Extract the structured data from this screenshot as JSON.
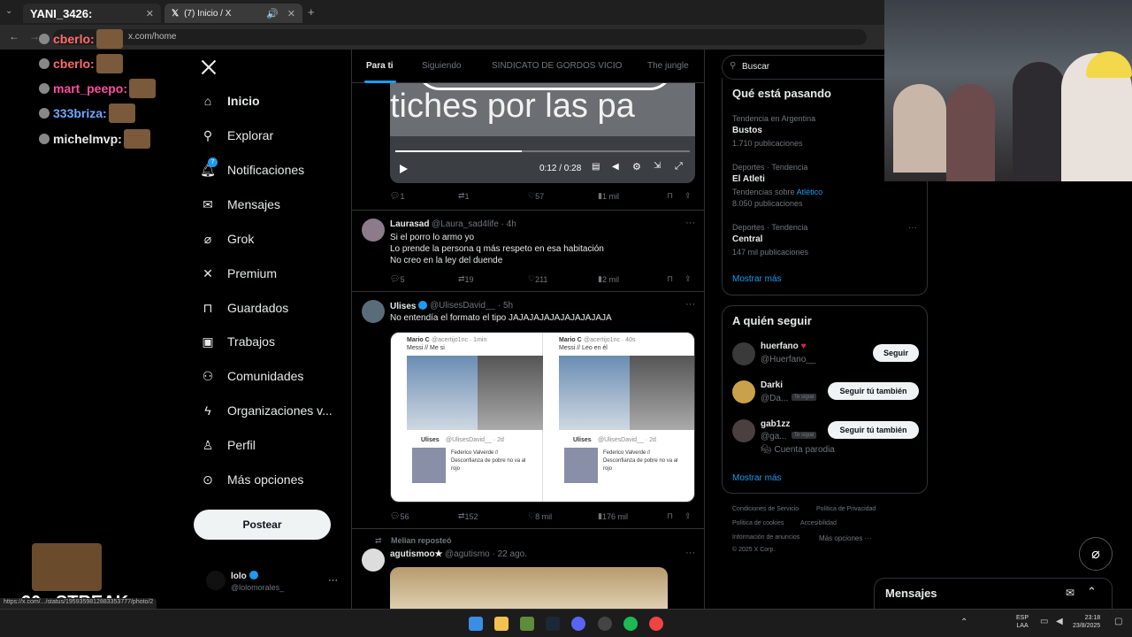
{
  "browser": {
    "tab1_label": "YANI_3426:",
    "tab2_label": "(7) Inicio / X",
    "url": "x.com/home",
    "status_url": "https://x.com/.../status/1959359812883353777/photo/2"
  },
  "chat": [
    {
      "user": "cberlo:",
      "color": "#ff6b6b"
    },
    {
      "user": "cberlo:",
      "color": "#ff6b6b"
    },
    {
      "user": "mart_peepo:",
      "color": "#ff4fa3"
    },
    {
      "user": "333briza:",
      "color": "#6fa8ff"
    },
    {
      "user": "michelmvp:",
      "color": "#e8e8e8"
    }
  ],
  "streak": "20x STREAK",
  "nav": {
    "items": [
      {
        "label": "Inicio",
        "icon": "home-icon"
      },
      {
        "label": "Explorar",
        "icon": "search-icon"
      },
      {
        "label": "Notificaciones",
        "icon": "bell-icon",
        "badge": "7"
      },
      {
        "label": "Mensajes",
        "icon": "envelope-icon"
      },
      {
        "label": "Grok",
        "icon": "grok-icon"
      },
      {
        "label": "Premium",
        "icon": "x-logo-icon"
      },
      {
        "label": "Guardados",
        "icon": "bookmark-icon"
      },
      {
        "label": "Trabajos",
        "icon": "briefcase-icon"
      },
      {
        "label": "Comunidades",
        "icon": "people-icon"
      },
      {
        "label": "Organizaciones v...",
        "icon": "lightning-icon"
      },
      {
        "label": "Perfil",
        "icon": "person-icon"
      },
      {
        "label": "Más opciones",
        "icon": "more-circle-icon"
      }
    ],
    "post_label": "Postear",
    "account": {
      "name": "lolo",
      "handle": "@lolomorales_"
    }
  },
  "tabs": [
    "Para ti",
    "Siguiendo",
    "SINDICATO DE GORDOS VICIO",
    "The jungle"
  ],
  "video": {
    "caption_text": "tiches por las pa",
    "time": "0:12 / 0:28",
    "progress": 0.43
  },
  "posts": [
    {
      "id": "p0",
      "actions": {
        "replies": "1",
        "reposts": "1",
        "likes": "57",
        "views": "1 mil"
      }
    },
    {
      "id": "p1",
      "name": "Laurasad",
      "handle": "@Laura_sad4life · 4h",
      "lines": [
        "Si el porro lo armo yo",
        "Lo prende la persona q más respeto en esa habitación",
        "No creo en la ley del duende"
      ],
      "actions": {
        "replies": "5",
        "reposts": "19",
        "likes": "211",
        "views": "2 mil"
      }
    },
    {
      "id": "p2",
      "name": "Ulises",
      "handle": "@UlisesDavid__ · 5h",
      "lines": [
        "No entendía el formato el tipo JAJAJAJAJAJAJAJAJAJA"
      ],
      "embed_left": {
        "name": "Mario C",
        "handle": "@acertijo1nc · 1min",
        "text": "Messi // Me si",
        "quote_name": "Ulises",
        "quote_handle": "@UlisesDavid__ · 2d",
        "quote_text": "Federico Valverde // Desconfianza de pobre no va al rojo"
      },
      "embed_right": {
        "name": "Mario C",
        "handle": "@acertijo1nc · 40s",
        "text": "Messi // Leo en él",
        "quote_name": "Ulises",
        "quote_handle": "@UlisesDavid__ · 2d",
        "quote_text": "Federico Valverde // Desconfianza de pobre no va al rojo"
      },
      "actions": {
        "replies": "56",
        "reposts": "152",
        "likes": "8 mil",
        "views": "176 mil"
      }
    },
    {
      "id": "p3",
      "repost_note": "Melian reposteó",
      "name": "agutismoo★",
      "handle": "@agutismo · 22 ago."
    }
  ],
  "search_placeholder": "Buscar",
  "trends": {
    "title": "Qué está pasando",
    "items": [
      {
        "context": "Tendencia en Argentina",
        "name": "Bustos",
        "count": "1.710 publicaciones"
      },
      {
        "context": "Deportes · Tendencia",
        "name": "El Atleti",
        "extra": "Tendencias sobre",
        "extra_link": "Atlético",
        "count": "8.050 publicaciones"
      },
      {
        "context": "Deportes · Tendencia",
        "name": "Central",
        "count": "147 mil publicaciones"
      }
    ],
    "show_more": "Mostrar más"
  },
  "who_to_follow": {
    "title": "A quién seguir",
    "items": [
      {
        "name": "huerfano",
        "handle": "@Huerfano__",
        "button": "Seguir"
      },
      {
        "name": "Darki",
        "handle": "@Da...",
        "badge": "Te sigue",
        "button": "Seguir tú también"
      },
      {
        "name": "gab1zz",
        "handle": "@ga...",
        "badge": "Te sigue",
        "button": "Seguir tú también",
        "note": "Cuenta parodia"
      }
    ],
    "show_more": "Mostrar más"
  },
  "footer": {
    "links": [
      "Condiciones de Servicio",
      "Política de Privacidad",
      "Política de cookies",
      "Accesibilidad",
      "Información de anuncios",
      "Más opciones ···"
    ],
    "copyright": "© 2025 X Corp."
  },
  "messages_label": "Mensajes",
  "taskbar": {
    "lang1": "ESP",
    "lang2": "LAA",
    "time": "23:18",
    "date": "23/8/2025"
  },
  "colors": {
    "accent": "#1d9bf0",
    "bg": "#000000",
    "border": "#2f3336",
    "muted": "#71767b"
  }
}
